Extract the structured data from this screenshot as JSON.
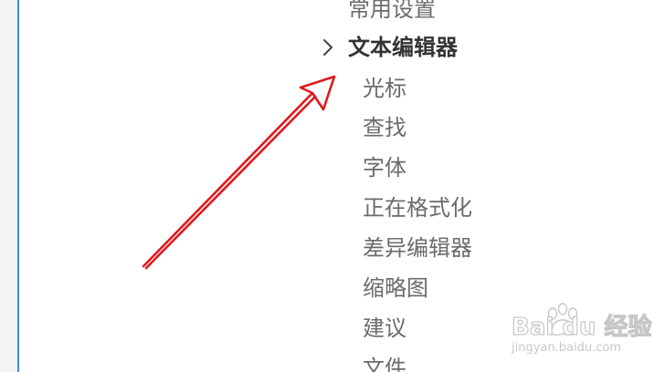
{
  "settings_tree": {
    "top_item": "常用设置",
    "section": {
      "label": "文本编辑器",
      "expanded_icon": "chevron-right-icon",
      "children": [
        "光标",
        "查找",
        "字体",
        "正在格式化",
        "差异编辑器",
        "缩略图",
        "建议",
        "文件"
      ]
    }
  },
  "watermark": {
    "brand": "Bai du 经验",
    "url": "jingyan.baidu.com"
  },
  "colors": {
    "accent_border": "#3a8ee6",
    "arrow": "#e0191e",
    "text_parent": "#333333",
    "text_child": "#6b6b6b"
  }
}
